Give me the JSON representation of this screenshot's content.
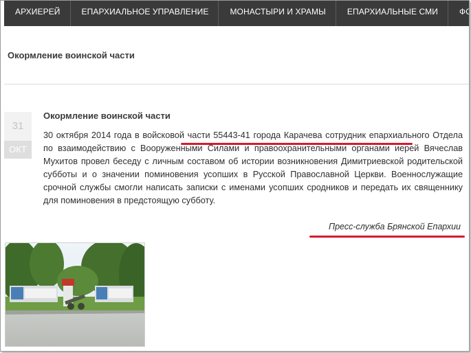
{
  "nav": {
    "items": [
      "АРХИЕРЕЙ",
      "ЕПАРХИАЛЬНОЕ УПРАВЛЕНИЕ",
      "МОНАСТЫРИ И ХРАМЫ",
      "ЕПАРХИАЛЬНЫЕ СМИ",
      "ФОТО И"
    ]
  },
  "page": {
    "title": "Окормление воинской части"
  },
  "article": {
    "date": {
      "day": "31",
      "month": "ОКТ"
    },
    "title": "Окормление воинской части",
    "body_part1": "30 октября 2014 года в ",
    "body_highlight": "войсковой части 55443-41 города Карачева",
    "body_part2": " сотрудник епархиального Отдела по взаимодействию с Вооруженными Силами и правоохранительными органами иерей Вячеслав Мухитов провел беседу с личным составом об истории возникновения Димитриевской родительской субботы и о значении поминовения усопших в Русской Православной Церкви. Военнослужащие срочной службы смогли написать записки с именами усопших сродников и передать их священнику для поминовения в предстоящую субботу.",
    "signature": "Пресс-служба Брянской Епархии"
  },
  "colors": {
    "nav_bg": "#3a3a3a",
    "annotation_red": "#d8192f"
  }
}
